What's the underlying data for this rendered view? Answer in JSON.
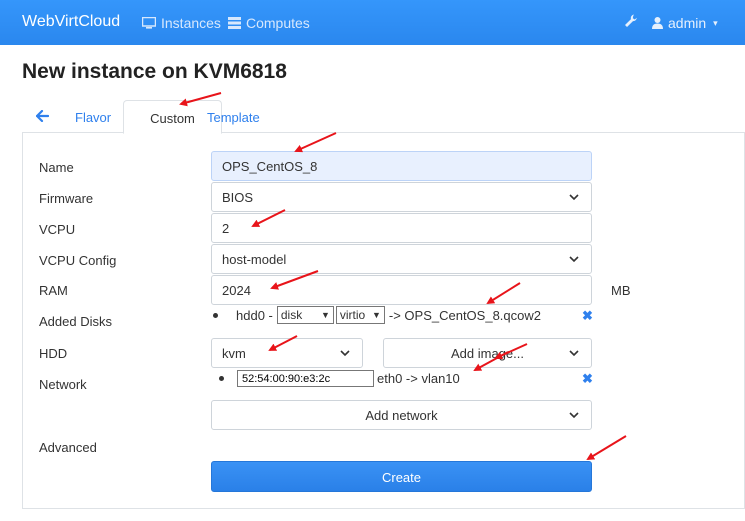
{
  "navbar": {
    "brand": "WebVirtCloud",
    "instances": "Instances",
    "computes": "Computes",
    "user": "admin"
  },
  "page": {
    "title": "New instance on KVM6818"
  },
  "tabs": {
    "flavor": "Flavor",
    "custom": "Custom",
    "template": "Template"
  },
  "form": {
    "name_label": "Name",
    "name_value": "OPS_CentOS_8",
    "firmware_label": "Firmware",
    "firmware_value": "BIOS",
    "vcpu_label": "VCPU",
    "vcpu_value": "2",
    "vcpu_config_label": "VCPU Config",
    "vcpu_config_value": "host-model",
    "ram_label": "RAM",
    "ram_value": "2024",
    "ram_unit": "MB",
    "added_disks_label": "Added Disks",
    "disk": {
      "name": "hdd0 -",
      "device": "disk",
      "bus": "virtio",
      "target": "-> OPS_CentOS_8.qcow2"
    },
    "hdd_label": "HDD",
    "hdd_value": "kvm",
    "add_image": "Add image...",
    "network_label": "Network",
    "network": {
      "mac": "52:54:00:90:e3:2c",
      "target": "eth0 -> vlan10"
    },
    "add_network": "Add network",
    "advanced_label": "Advanced",
    "create_button": "Create"
  },
  "colors": {
    "navbar": "#2f8ff5",
    "accent": "#2f80ed",
    "arrow": "#e8141a"
  }
}
